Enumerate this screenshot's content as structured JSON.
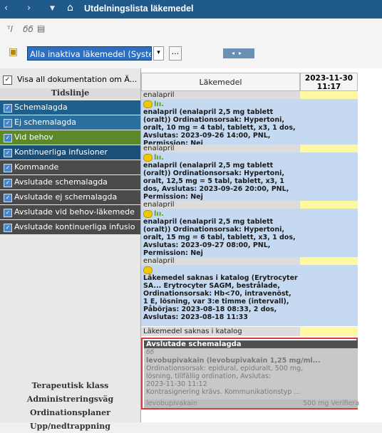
{
  "titlebar": {
    "title": "Utdelningslista läkemedel",
    "back_icon": "chevron-left-icon",
    "forward_icon": "chevron-right-icon",
    "dropdown_icon": "caret-down-icon",
    "home_icon": "home-icon"
  },
  "toolbar": {
    "icons": [
      "pill-history-icon",
      "glasses-icon",
      "document-icon"
    ]
  },
  "filter": {
    "value": "Alla inaktiva läkemedel (System)",
    "more_label": "...",
    "pager_prev": "◂",
    "pager_next": "▸"
  },
  "left_panel": {
    "show_all_label": "Visa all dokumentation om Ä...",
    "timeline_header": "Tidslinje",
    "categories": [
      {
        "label": "Schemalagda",
        "color": "#1f5f8b"
      },
      {
        "label": "Ej schemalagda",
        "color": "#2a6f9e"
      },
      {
        "label": "Vid behov",
        "color": "#5c8a2a"
      },
      {
        "label": "Kontinuerliga infusioner",
        "color": "#1b4f78"
      },
      {
        "label": "Kommande",
        "color": "#4a4a4a"
      },
      {
        "label": "Avslutade schemalagda",
        "color": "#4a4a4a"
      },
      {
        "label": "Avslutade ej schemalagda",
        "color": "#4a4a4a"
      },
      {
        "label": "Avslutade vid behov-läkemede",
        "color": "#4a4a4a"
      },
      {
        "label": "Avslutade kontinuerliga infusio",
        "color": "#4a4a4a"
      }
    ],
    "bottom_links": [
      "Terapeutisk klass",
      "Administreringsväg",
      "Ordinationsplaner",
      "Upp/nedtrappning"
    ]
  },
  "grid": {
    "col_medication": "Läkemedel",
    "col_date_line1": "2023-11-30",
    "col_date_line2": "11:17",
    "rows": [
      {
        "name": "enalapril",
        "detail": "enalapril (enalapril 2,5 mg tablett (oralt)) Ordinationsorsak: Hypertoni, oralt, 10 mg = 4 tabl, tablett, x3, 1 dos, Avslutas: 2023-09-26 14:00, PNL, Permission: Nej"
      },
      {
        "name": "enalapril",
        "detail": "enalapril (enalapril 2,5 mg tablett (oralt)) Ordinationsorsak: Hypertoni, oralt, 12,5 mg = 5 tabl, tablett, x3, 1 dos, Avslutas: 2023-09-26 20:00, PNL, Permission: Nej"
      },
      {
        "name": "enalapril",
        "detail": "enalapril (enalapril 2,5 mg tablett (oralt)) Ordinationsorsak: Hypertoni, oralt, 15 mg = 6 tabl, tablett, x3, 1 dos, Avslutas: 2023-09-27 08:00, PNL, Permission: Nej"
      },
      {
        "name": "enalapril",
        "detail": "Läkemedel saknas i katalog (Erytrocyter SA... Erytrocyter SAGM, bestrålade, Ordinationsorsak: Hb<70, intravenöst, 1 E, lösning, var 3:e timme (intervall), Påbörjas: 2023-08-18 08:33, 2 dos, Avslutas: 2023-08-18 11:33"
      }
    ],
    "missing_row": "Läkemedel saknas i katalog",
    "selected": {
      "header": "Avslutade schemalagda",
      "line1": "levobupivakain (levobupivakain 1,25 mg/ml...",
      "line2": "Ordinationsorsak: epidural, epiduralt, 500 mg,",
      "line3": "lösning, tillfällig ordination, Avslutas:",
      "line4": "2023-11-30 11:12",
      "line5": "Kontrasignering krävs. Kommunikationstyp ...",
      "foot_name": "levobupivakain",
      "foot_value": "500 mg Verifiera"
    }
  }
}
